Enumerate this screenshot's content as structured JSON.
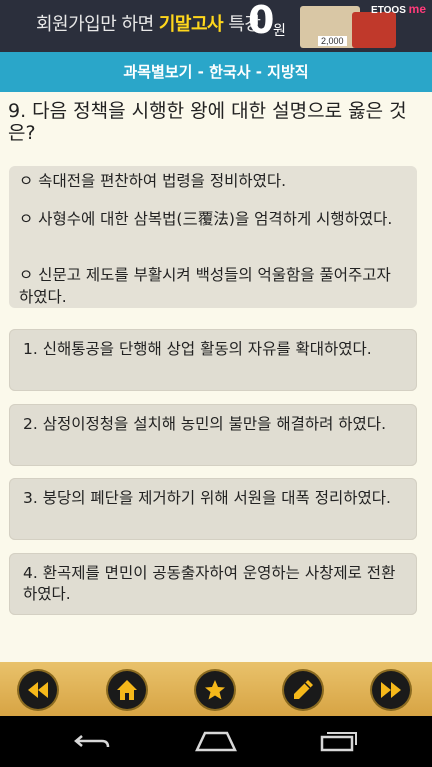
{
  "ad": {
    "text_before": "회원가입만 하면 ",
    "highlight": "기말고사",
    "text_after": " 특강",
    "zero": "0",
    "won": "원",
    "brand_prefix": "ETOOS",
    "brand_suffix": "me",
    "price": "2,000"
  },
  "header": {
    "breadcrumb": "과목별보기 - 한국사 - 지방직"
  },
  "question": {
    "text": "9. 다음 정책을 시행한 왕에 대한 설명으로 옳은 것은?"
  },
  "conditions": [
    "ㅇ 속대전을 편찬하여 법령을 정비하였다.",
    "ㅇ 사형수에 대한 삼복법(三覆法)을 엄격하게 시행하였다.",
    "ㅇ 신문고 제도를 부활시켜 백성들의 억울함을 풀어주고자 하였다."
  ],
  "options": [
    "1. 신해통공을 단행해 상업 활동의 자유를 확대하였다.",
    "2. 삼정이정청을 설치해 농민의 불만을 해결하려 하였다.",
    "3. 붕당의 폐단을 제거하기 위해 서원을 대폭 정리하였다.",
    "4. 환곡제를 면민이 공동출자하여 운영하는 사창제로 전환하였다."
  ],
  "toolbar": {
    "icons": [
      "rewind-icon",
      "home-icon",
      "star-icon",
      "pencil-icon",
      "fast-forward-icon"
    ],
    "accent": "#f5b81a"
  },
  "colors": {
    "title_bar": "#2aa6c9",
    "background": "#fbf9eb",
    "card": "#e4e1d6"
  }
}
